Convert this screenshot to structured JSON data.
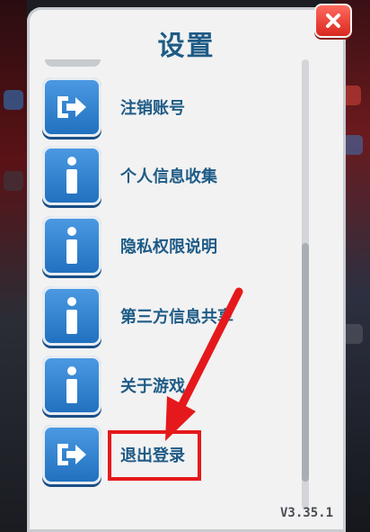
{
  "dialog": {
    "title": "设置",
    "items": [
      {
        "label": "注销账号",
        "icon": "exit-arrow-icon"
      },
      {
        "label": "个人信息收集",
        "icon": "info-icon"
      },
      {
        "label": "隐私权限说明",
        "icon": "info-icon"
      },
      {
        "label": "第三方信息共享",
        "icon": "info-icon"
      },
      {
        "label": "关于游戏",
        "icon": "info-icon"
      },
      {
        "label": "退出登录",
        "icon": "exit-arrow-icon"
      }
    ],
    "version": "V3.35.1"
  },
  "annotation": {
    "highlighted_item": "退出登录",
    "color": "#e5191b"
  },
  "colors": {
    "accent": "#1e5b86",
    "button": "#2f84d1",
    "close": "#e03a2f"
  }
}
